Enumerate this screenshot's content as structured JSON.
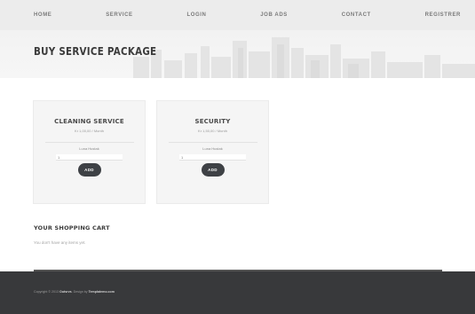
{
  "nav": {
    "home": "HOME",
    "service": "SERVICE",
    "login": "LOGIN",
    "job_ads": "JOB ADS",
    "contact": "CONTACT",
    "register": "REGISTRER"
  },
  "header": {
    "title": "BUY SERVICE PACKAGE"
  },
  "packages": [
    {
      "title": "CLEANING SERVICE",
      "price": "Kr 1,00,00 / Month",
      "select_label": "Luna Hustak",
      "quantity": "1",
      "add_label": "ADD"
    },
    {
      "title": "SECURITY",
      "price": "Kr 1,50,00 / Month",
      "select_label": "Luna Hustak",
      "quantity": "1",
      "add_label": "ADD"
    }
  ],
  "cart": {
    "title": "YOUR SHOPPING CART",
    "empty_text": "You don't have any items yet."
  },
  "footer": {
    "copyright_prefix": "Copyright © 2013",
    "site_link": "Outsrvs",
    "design_prefix": ". Design by",
    "designer_link": "Templatemo.com"
  },
  "colors": {
    "nav_bg": "#ececec",
    "card_bg": "#f5f5f5",
    "button_bg": "#3e4145",
    "footer_bg": "#38393b"
  }
}
